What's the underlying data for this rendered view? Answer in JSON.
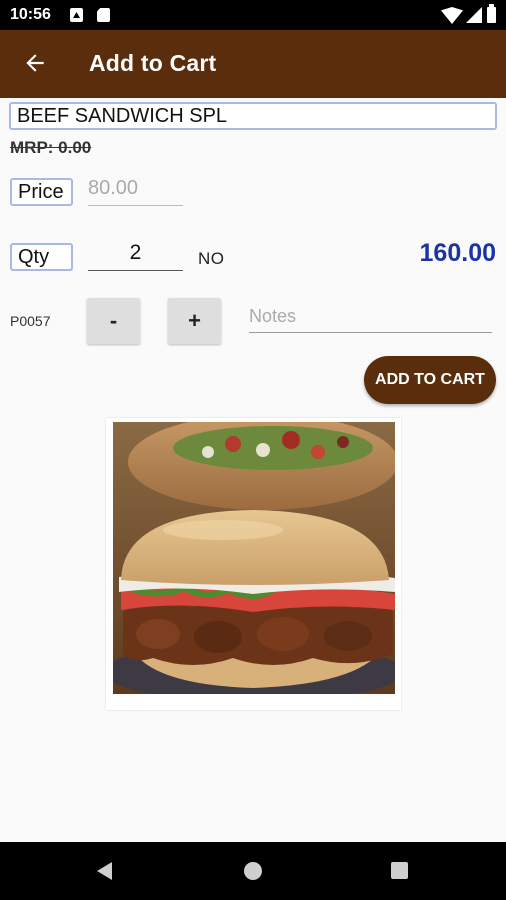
{
  "status_bar": {
    "time": "10:56",
    "icons": [
      "a-notification-icon",
      "sd-card-icon",
      "wifi-icon",
      "signal-icon",
      "battery-icon"
    ]
  },
  "app_bar": {
    "back_icon": "arrow-left-icon",
    "title": "Add to Cart",
    "color": "#5a2d0c"
  },
  "product": {
    "name": "BEEF SANDWICH SPL",
    "mrp": "MRP: 0.00",
    "code": "P0057",
    "image": "beef-sandwich-photo"
  },
  "form": {
    "price_label": "Price",
    "price_value": "80.00",
    "qty_label": "Qty",
    "qty_value": "2",
    "unit": "NO",
    "total": "160.00",
    "total_color": "#1b33a6",
    "minus_label": "-",
    "plus_label": "+",
    "notes_placeholder": "Notes",
    "add_to_cart_label": "ADD TO CART"
  },
  "nav_bar": {
    "icons": [
      "back-triangle-icon",
      "home-circle-icon",
      "recents-square-icon"
    ]
  }
}
